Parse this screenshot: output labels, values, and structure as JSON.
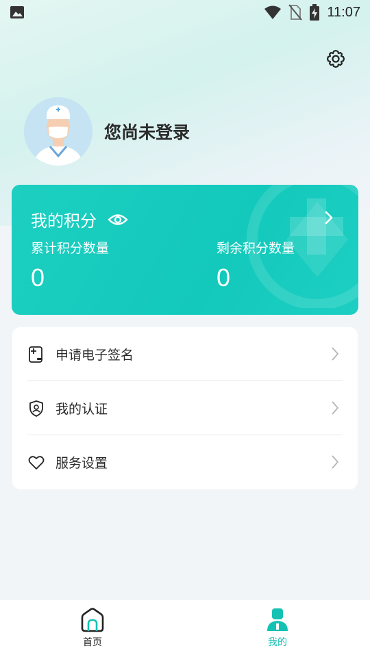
{
  "status_bar": {
    "time": "11:07",
    "icons": [
      "image-icon",
      "wifi-icon",
      "no-sim-icon",
      "battery-charging-icon"
    ]
  },
  "header": {
    "settings_icon": "gear-icon"
  },
  "profile": {
    "login_text": "您尚未登录",
    "avatar_icon": "doctor-avatar"
  },
  "points": {
    "title": "我的积分",
    "eye_icon": "eye-icon",
    "total_label": "累计积分数量",
    "total_value": "0",
    "remaining_label": "剩余积分数量",
    "remaining_value": "0",
    "accent_color": "#13c9bb"
  },
  "menu": {
    "items": [
      {
        "label": "申请电子签名",
        "icon": "phone-plus-icon"
      },
      {
        "label": "我的认证",
        "icon": "shield-user-icon"
      },
      {
        "label": "服务设置",
        "icon": "heart-icon"
      }
    ]
  },
  "tabbar": {
    "tabs": [
      {
        "label": "首页",
        "icon": "home-icon",
        "active": false
      },
      {
        "label": "我的",
        "icon": "person-icon",
        "active": true
      }
    ],
    "active_color": "#13c2b2"
  }
}
